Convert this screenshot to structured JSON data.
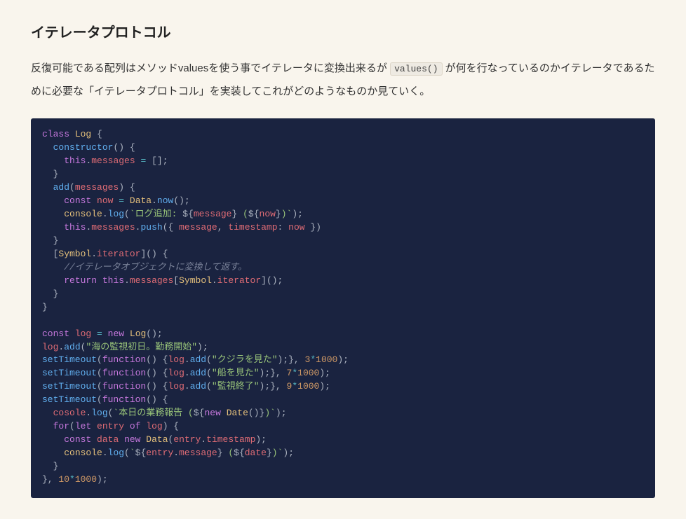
{
  "heading": "イテレータプロトコル",
  "paragraph": {
    "before": "反復可能である配列はメソッドvaluesを使う事でイテレータに変換出来るが ",
    "code": "values()",
    "after": " が何を行なっているのかイテレータであるために必要な「イテレータプロトコル」を実装してこれがどのようなものか見ていく。"
  },
  "code": {
    "lines": [
      [
        [
          "kw",
          "class"
        ],
        [
          "punc",
          " "
        ],
        [
          "cls",
          "Log"
        ],
        [
          "punc",
          " {"
        ]
      ],
      [
        [
          "punc",
          "  "
        ],
        [
          "fn",
          "constructor"
        ],
        [
          "punc",
          "() {"
        ]
      ],
      [
        [
          "punc",
          "    "
        ],
        [
          "kw",
          "this"
        ],
        [
          "punc",
          "."
        ],
        [
          "prop",
          "messages"
        ],
        [
          "punc",
          " "
        ],
        [
          "op",
          "="
        ],
        [
          "punc",
          " [];"
        ]
      ],
      [
        [
          "punc",
          "  }"
        ]
      ],
      [
        [
          "punc",
          "  "
        ],
        [
          "fn",
          "add"
        ],
        [
          "punc",
          "("
        ],
        [
          "var",
          "messages"
        ],
        [
          "punc",
          ") {"
        ]
      ],
      [
        [
          "punc",
          "    "
        ],
        [
          "kw",
          "const"
        ],
        [
          "punc",
          " "
        ],
        [
          "var",
          "now"
        ],
        [
          "punc",
          " "
        ],
        [
          "op",
          "="
        ],
        [
          "punc",
          " "
        ],
        [
          "cls",
          "Data"
        ],
        [
          "punc",
          "."
        ],
        [
          "fn",
          "now"
        ],
        [
          "punc",
          "();"
        ]
      ],
      [
        [
          "punc",
          "    "
        ],
        [
          "cls",
          "console"
        ],
        [
          "punc",
          "."
        ],
        [
          "fn",
          "log"
        ],
        [
          "punc",
          "("
        ],
        [
          "tmpl",
          "`ログ追加: "
        ],
        [
          "punc",
          "${"
        ],
        [
          "intp",
          "message"
        ],
        [
          "punc",
          "}"
        ],
        [
          "tmpl",
          " ("
        ],
        [
          "punc",
          "${"
        ],
        [
          "intp",
          "now"
        ],
        [
          "punc",
          "}"
        ],
        [
          "tmpl",
          ")`"
        ],
        [
          "punc",
          ");"
        ]
      ],
      [
        [
          "punc",
          "    "
        ],
        [
          "kw",
          "this"
        ],
        [
          "punc",
          "."
        ],
        [
          "prop",
          "messages"
        ],
        [
          "punc",
          "."
        ],
        [
          "fn",
          "push"
        ],
        [
          "punc",
          "({ "
        ],
        [
          "prop",
          "message"
        ],
        [
          "punc",
          ", "
        ],
        [
          "prop",
          "timestamp"
        ],
        [
          "punc",
          ": "
        ],
        [
          "var",
          "now"
        ],
        [
          "punc",
          " })"
        ]
      ],
      [
        [
          "punc",
          "  }"
        ]
      ],
      [
        [
          "punc",
          "  ["
        ],
        [
          "cls",
          "Symbol"
        ],
        [
          "punc",
          "."
        ],
        [
          "prop",
          "iterator"
        ],
        [
          "punc",
          "]() {"
        ]
      ],
      [
        [
          "punc",
          "    "
        ],
        [
          "cmt",
          "//イテレータオブジェクトに変換して返す。"
        ]
      ],
      [
        [
          "punc",
          "    "
        ],
        [
          "kw",
          "return"
        ],
        [
          "punc",
          " "
        ],
        [
          "kw",
          "this"
        ],
        [
          "punc",
          "."
        ],
        [
          "prop",
          "messages"
        ],
        [
          "punc",
          "["
        ],
        [
          "cls",
          "Symbol"
        ],
        [
          "punc",
          "."
        ],
        [
          "prop",
          "iterator"
        ],
        [
          "punc",
          "]();"
        ]
      ],
      [
        [
          "punc",
          "  }"
        ]
      ],
      [
        [
          "punc",
          "}"
        ]
      ],
      [
        [
          "punc",
          ""
        ]
      ],
      [
        [
          "kw",
          "const"
        ],
        [
          "punc",
          " "
        ],
        [
          "var",
          "log"
        ],
        [
          "punc",
          " "
        ],
        [
          "op",
          "="
        ],
        [
          "punc",
          " "
        ],
        [
          "kw",
          "new"
        ],
        [
          "punc",
          " "
        ],
        [
          "cls",
          "Log"
        ],
        [
          "punc",
          "();"
        ]
      ],
      [
        [
          "var",
          "log"
        ],
        [
          "punc",
          "."
        ],
        [
          "fn",
          "add"
        ],
        [
          "punc",
          "("
        ],
        [
          "str",
          "\"海の監視初日。勤務開始\""
        ],
        [
          "punc",
          ");"
        ]
      ],
      [
        [
          "fn",
          "setTimeout"
        ],
        [
          "punc",
          "("
        ],
        [
          "kw",
          "function"
        ],
        [
          "punc",
          "() {"
        ],
        [
          "var",
          "log"
        ],
        [
          "punc",
          "."
        ],
        [
          "fn",
          "add"
        ],
        [
          "punc",
          "("
        ],
        [
          "str",
          "\"クジラを見た\""
        ],
        [
          "punc",
          ");}, "
        ],
        [
          "num",
          "3"
        ],
        [
          "op",
          "*"
        ],
        [
          "num",
          "1000"
        ],
        [
          "punc",
          ");"
        ]
      ],
      [
        [
          "fn",
          "setTimeout"
        ],
        [
          "punc",
          "("
        ],
        [
          "kw",
          "function"
        ],
        [
          "punc",
          "() {"
        ],
        [
          "var",
          "log"
        ],
        [
          "punc",
          "."
        ],
        [
          "fn",
          "add"
        ],
        [
          "punc",
          "("
        ],
        [
          "str",
          "\"船を見た\""
        ],
        [
          "punc",
          ");}, "
        ],
        [
          "num",
          "7"
        ],
        [
          "op",
          "*"
        ],
        [
          "num",
          "1000"
        ],
        [
          "punc",
          ");"
        ]
      ],
      [
        [
          "fn",
          "setTimeout"
        ],
        [
          "punc",
          "("
        ],
        [
          "kw",
          "function"
        ],
        [
          "punc",
          "() {"
        ],
        [
          "var",
          "log"
        ],
        [
          "punc",
          "."
        ],
        [
          "fn",
          "add"
        ],
        [
          "punc",
          "("
        ],
        [
          "str",
          "\"監視終了\""
        ],
        [
          "punc",
          ");}, "
        ],
        [
          "num",
          "9"
        ],
        [
          "op",
          "*"
        ],
        [
          "num",
          "1000"
        ],
        [
          "punc",
          ");"
        ]
      ],
      [
        [
          "fn",
          "setTimeout"
        ],
        [
          "punc",
          "("
        ],
        [
          "kw",
          "function"
        ],
        [
          "punc",
          "() {"
        ]
      ],
      [
        [
          "punc",
          "  "
        ],
        [
          "var",
          "cosole"
        ],
        [
          "punc",
          "."
        ],
        [
          "fn",
          "log"
        ],
        [
          "punc",
          "("
        ],
        [
          "tmpl",
          "`本日の業務報告 ("
        ],
        [
          "punc",
          "${"
        ],
        [
          "kw",
          "new"
        ],
        [
          "punc",
          " "
        ],
        [
          "cls",
          "Date"
        ],
        [
          "punc",
          "()}"
        ],
        [
          "tmpl",
          ")`"
        ],
        [
          "punc",
          ");"
        ]
      ],
      [
        [
          "punc",
          "  "
        ],
        [
          "kw",
          "for"
        ],
        [
          "punc",
          "("
        ],
        [
          "kw",
          "let"
        ],
        [
          "punc",
          " "
        ],
        [
          "var",
          "entry"
        ],
        [
          "punc",
          " "
        ],
        [
          "kw",
          "of"
        ],
        [
          "punc",
          " "
        ],
        [
          "var",
          "log"
        ],
        [
          "punc",
          ") {"
        ]
      ],
      [
        [
          "punc",
          "    "
        ],
        [
          "kw",
          "const"
        ],
        [
          "punc",
          " "
        ],
        [
          "var",
          "data"
        ],
        [
          "punc",
          " "
        ],
        [
          "kw",
          "new"
        ],
        [
          "punc",
          " "
        ],
        [
          "cls",
          "Data"
        ],
        [
          "punc",
          "("
        ],
        [
          "var",
          "entry"
        ],
        [
          "punc",
          "."
        ],
        [
          "prop",
          "timestamp"
        ],
        [
          "punc",
          ");"
        ]
      ],
      [
        [
          "punc",
          "    "
        ],
        [
          "cls",
          "console"
        ],
        [
          "punc",
          "."
        ],
        [
          "fn",
          "log"
        ],
        [
          "punc",
          "("
        ],
        [
          "tmpl",
          "`"
        ],
        [
          "punc",
          "${"
        ],
        [
          "var",
          "entry"
        ],
        [
          "punc",
          "."
        ],
        [
          "prop",
          "message"
        ],
        [
          "punc",
          "}"
        ],
        [
          "tmpl",
          " ("
        ],
        [
          "punc",
          "${"
        ],
        [
          "intp",
          "date"
        ],
        [
          "punc",
          "}"
        ],
        [
          "tmpl",
          ")`"
        ],
        [
          "punc",
          ");"
        ]
      ],
      [
        [
          "punc",
          "  }"
        ]
      ],
      [
        [
          "punc",
          "}, "
        ],
        [
          "num",
          "10"
        ],
        [
          "op",
          "*"
        ],
        [
          "num",
          "1000"
        ],
        [
          "punc",
          ");"
        ]
      ]
    ]
  }
}
